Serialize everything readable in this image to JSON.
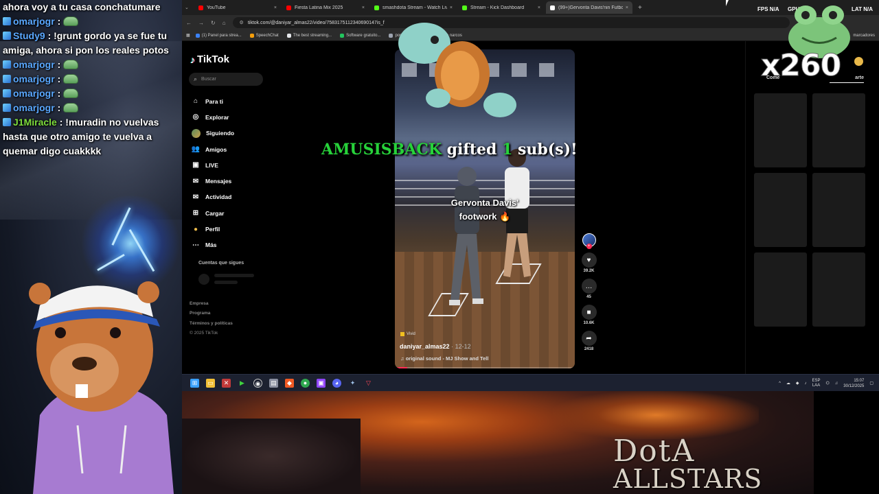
{
  "chat": {
    "messages": [
      {
        "user": "",
        "text": "ahora voy a tu casa conchatumare",
        "color": "#ffffff",
        "emote": false
      },
      {
        "user": "omarjogr",
        "text": "",
        "color": "#5aa8ff",
        "emote": true
      },
      {
        "user": "Study9",
        "text": "!grunt gordo ya se fue tu amiga, ahora si pon los reales potos",
        "color": "#5aa8ff",
        "emote": false
      },
      {
        "user": "omarjogr",
        "text": "",
        "color": "#5aa8ff",
        "emote": true
      },
      {
        "user": "omarjogr",
        "text": "",
        "color": "#5aa8ff",
        "emote": true
      },
      {
        "user": "omarjogr",
        "text": "",
        "color": "#5aa8ff",
        "emote": true
      },
      {
        "user": "omarjogr",
        "text": "",
        "color": "#5aa8ff",
        "emote": true
      },
      {
        "user": "J1Miracle",
        "text": "!muradin no vuelvas hasta que otro amigo te vuelva a quemar digo cuakkkk",
        "color": "#7ddc3c",
        "emote": false
      }
    ]
  },
  "browser": {
    "tabs": [
      {
        "title": "YouTube",
        "color": "#ff0000",
        "active": false
      },
      {
        "title": "Fiesta Latina Mix 2025",
        "color": "#ff0000",
        "active": false
      },
      {
        "title": "smashdota Stream - Watch Live",
        "color": "#53fc18",
        "active": false
      },
      {
        "title": "Stream - Kick Dashboard",
        "color": "#53fc18",
        "active": false
      },
      {
        "title": "(99+)Gervonta Davis'nin Futbol",
        "color": "#ffffff",
        "active": true
      }
    ],
    "url": "tiktok.com/@daniyar_almas22/video/7583175112340690147is_f",
    "bookmarks": [
      {
        "label": "(1) Panel para strea...",
        "color": "#3b82f6"
      },
      {
        "label": "SpeechChat",
        "color": "#f59e0b"
      },
      {
        "label": "The best streaming...",
        "color": "#e5e7eb"
      },
      {
        "label": "Software gratuito...",
        "color": "#22c55e"
      },
      {
        "label": "por 5 subs",
        "color": "#9ca3af"
      },
      {
        "label": "ruleta para narcos",
        "color": "#9ca3af"
      }
    ],
    "bookmarks_right": "marcadores"
  },
  "tiktok": {
    "logo": "TikTok",
    "search_placeholder": "Buscar",
    "nav": [
      {
        "label": "Para ti",
        "icon": "home-icon"
      },
      {
        "label": "Explorar",
        "icon": "compass-icon"
      },
      {
        "label": "Siguiendo",
        "icon": "following-avatar-icon"
      },
      {
        "label": "Amigos",
        "icon": "friends-icon"
      },
      {
        "label": "LIVE",
        "icon": "live-icon"
      },
      {
        "label": "Mensajes",
        "icon": "messages-icon"
      },
      {
        "label": "Actividad",
        "icon": "activity-icon"
      },
      {
        "label": "Cargar",
        "icon": "upload-icon"
      },
      {
        "label": "Perfil",
        "icon": "profile-icon"
      },
      {
        "label": "Más",
        "icon": "more-icon"
      }
    ],
    "following_title": "Cuentas que sigues",
    "footer": {
      "company": "Empresa",
      "program": "Programa",
      "terms": "Términos y políticas",
      "copyright": "© 2025 TikTok"
    },
    "video": {
      "caption": "Gervonta Davis' footwork 🔥",
      "effect_label": "Vivid",
      "author": "daniyar_almas22",
      "date": "12-12",
      "sound": "original sound - MJ Show and Tell",
      "progress": 0.07
    },
    "actions": {
      "likes": "39.2K",
      "comments": "45",
      "saves": "10.6K",
      "shares": "2418"
    },
    "right_panel": {
      "comments_tab": "Come",
      "share_tab": "arte"
    }
  },
  "overlay": {
    "gift_user": "AMUSISBACK",
    "gift_text1": "gifted",
    "gift_count": "1",
    "gift_text2": "sub(s)!",
    "multiplier": "x260",
    "fps_label": "FPS",
    "fps_value": "N/A",
    "gpu_label": "GPU",
    "lat_label": "LAT",
    "lat_value": "N/A"
  },
  "taskbar": {
    "lang_top": "ESP",
    "lang_bottom": "LAA",
    "time": "15:07",
    "date": "30/12/2025"
  },
  "game": {
    "title_line1": "DotA",
    "title_line2": "ALLSTARS"
  }
}
